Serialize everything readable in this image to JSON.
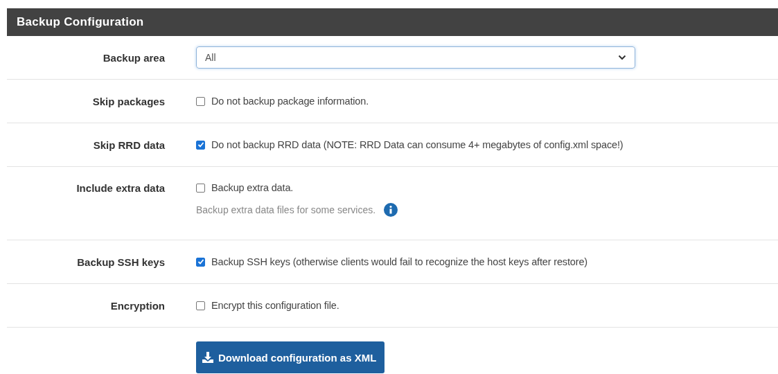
{
  "panel": {
    "title": "Backup Configuration"
  },
  "rows": [
    {
      "kind": "select",
      "label": "Backup area",
      "value": "All"
    },
    {
      "kind": "checkbox",
      "label": "Skip packages",
      "text": "Do not backup package information.",
      "checked": false
    },
    {
      "kind": "checkbox",
      "label": "Skip RRD data",
      "text": "Do not backup RRD data (NOTE: RRD Data can consume 4+ megabytes of config.xml space!)",
      "checked": true
    },
    {
      "kind": "checkbox",
      "label": "Include extra data",
      "text": "Backup extra data.",
      "checked": false,
      "help": "Backup extra data files for some services."
    },
    {
      "kind": "checkbox",
      "label": "Backup SSH keys",
      "text": "Backup SSH keys (otherwise clients would fail to recognize the host keys after restore)",
      "checked": true
    },
    {
      "kind": "checkbox",
      "label": "Encryption",
      "text": "Encrypt this configuration file.",
      "checked": false
    }
  ],
  "download_button": {
    "label": "Download configuration as XML"
  }
}
